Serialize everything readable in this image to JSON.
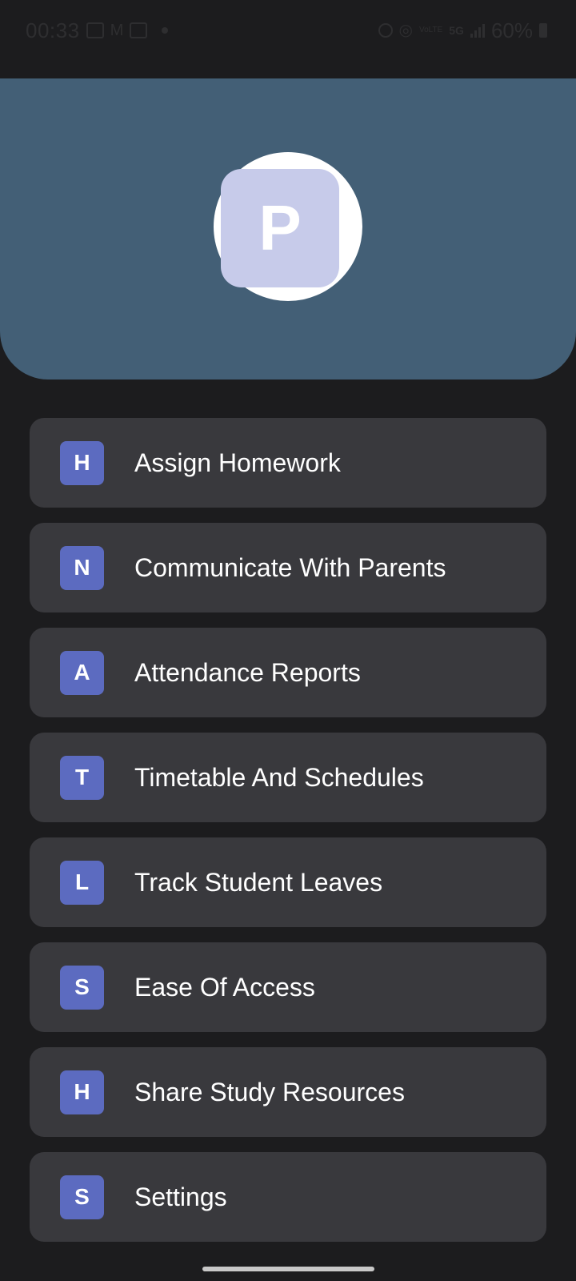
{
  "status_bar": {
    "time": "00:33",
    "battery_percent": "60%",
    "left_icons": [
      "gallery-icon",
      "gmail-icon",
      "photo-icon"
    ],
    "right_icons": [
      "alarm-icon",
      "hotspot-icon",
      "volte-icon",
      "5g-icon",
      "signal-icon",
      "battery-icon"
    ],
    "volte_label": "VoLTE",
    "network_label": "5G"
  },
  "header": {
    "background": "#435f76",
    "avatar_letter": "P"
  },
  "menu": {
    "badge_color": "#5c6bc0",
    "items": [
      {
        "letter": "H",
        "label": "Assign Homework"
      },
      {
        "letter": "N",
        "label": "Communicate With Parents"
      },
      {
        "letter": "A",
        "label": "Attendance Reports"
      },
      {
        "letter": "T",
        "label": "Timetable And Schedules"
      },
      {
        "letter": "L",
        "label": "Track Student Leaves"
      },
      {
        "letter": "S",
        "label": "Ease Of Access"
      },
      {
        "letter": "H",
        "label": "Share Study Resources"
      },
      {
        "letter": "S",
        "label": "Settings"
      }
    ]
  }
}
